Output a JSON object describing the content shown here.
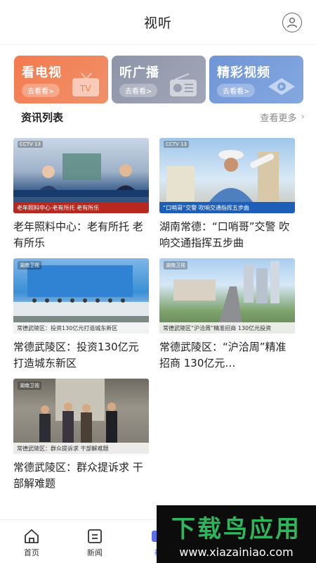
{
  "header": {
    "title": "视听"
  },
  "categories": [
    {
      "label": "看电视",
      "button": "去看看>"
    },
    {
      "label": "听广播",
      "button": "去看看>"
    },
    {
      "label": "精彩视频",
      "button": "去看看>"
    }
  ],
  "section": {
    "title": "资讯列表",
    "more": "查看更多"
  },
  "news": [
    {
      "title": "老年照料中心：老有所托 老有所乐",
      "thumb_caption": "老年照料中心·老有所托 老有所乐",
      "thumb_logo": "CCTV 13"
    },
    {
      "title": "湖南常德：“口哨哥”交警 吹响交通指挥五步曲",
      "thumb_caption": "“口哨哥”交警 吹响交通指挥五步曲",
      "thumb_logo": "CCTV 13"
    },
    {
      "title": "常德武陵区：投资130亿元打造城东新区",
      "thumb_caption": "常德武陵区：投资130亿元打造城东新区",
      "thumb_logo": "湖南卫视"
    },
    {
      "title": "常德武陵区：“沪洽周”精准招商 130亿元…",
      "thumb_caption": "常德武陵区“沪洽周”精准招商 130亿元投资",
      "thumb_logo": "湖南卫视"
    },
    {
      "title": "常德武陵区：群众提诉求 干部解难题",
      "thumb_caption": "常德武陵区：群众提诉求 干部解难题",
      "thumb_logo": "湖南卫视"
    }
  ],
  "tabs": [
    {
      "label": "首页"
    },
    {
      "label": "新闻"
    },
    {
      "label": "视"
    }
  ],
  "watermark": {
    "brand": "下载鸟应用",
    "url": "www.xiazainiao.com"
  }
}
